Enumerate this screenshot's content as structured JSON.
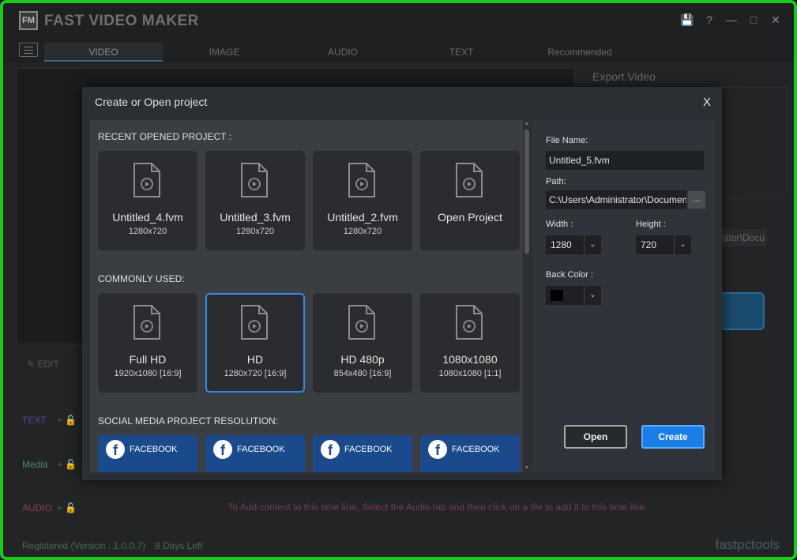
{
  "app": {
    "title": "FAST VIDEO MAKER",
    "logo": "FM"
  },
  "tabs": [
    "VIDEO",
    "IMAGE",
    "AUDIO",
    "TEXT",
    "Recommended"
  ],
  "background": {
    "export_title": "Export Video",
    "edit_label": "EDIT",
    "path_fragment": "rator\\Docu",
    "tracks": [
      {
        "label": "TEXT",
        "color": "#5a4a9a"
      },
      {
        "label": "Media",
        "color": "#4a8a6a"
      },
      {
        "label": "AUDIO",
        "color": "#8a3a5a"
      }
    ],
    "audio_message": "To Add content to this time line, Select the Audio tab and then click on a tile to add it to this time line.",
    "footer_registered": "Registered (Version : 1.0.0.7)",
    "footer_days": "8 Days Left",
    "brand": "fastpctools"
  },
  "dialog": {
    "title": "Create or Open project",
    "close": "X",
    "recent_label": "RECENT OPENED PROJECT :",
    "recent": [
      {
        "name": "Untitled_4.fvm",
        "res": "1280x720"
      },
      {
        "name": "Untitled_3.fvm",
        "res": "1280x720"
      },
      {
        "name": "Untitled_2.fvm",
        "res": "1280x720"
      },
      {
        "name": "Open Project",
        "res": ""
      }
    ],
    "common_label": "COMMONLY USED:",
    "common": [
      {
        "name": "Full HD",
        "res": "1920x1080 [16:9]"
      },
      {
        "name": "HD",
        "res": "1280x720 [16:9]"
      },
      {
        "name": "HD 480p",
        "res": "854x480 [16:9]"
      },
      {
        "name": "1080x1080",
        "res": "1080x1080 [1:1]"
      }
    ],
    "social_label": "SOCIAL MEDIA PROJECT RESOLUTION:",
    "social": [
      "FACEBOOK",
      "FACEBOOK",
      "FACEBOOK",
      "FACEBOOK"
    ],
    "form": {
      "file_name_label": "File Name:",
      "file_name": "Untitled_5.fvm",
      "path_label": "Path:",
      "path": "C:\\Users\\Administrator\\Documen",
      "browse": "...",
      "width_label": "Width :",
      "width": "1280",
      "height_label": "Height :",
      "height": "720",
      "back_color_label": "Back Color :",
      "back_color": "#000000",
      "open_button": "Open",
      "create_button": "Create"
    }
  },
  "colors": {
    "border": "#1ec81e",
    "accent": "#1a7ee6",
    "facebook": "#1a4a8c"
  }
}
